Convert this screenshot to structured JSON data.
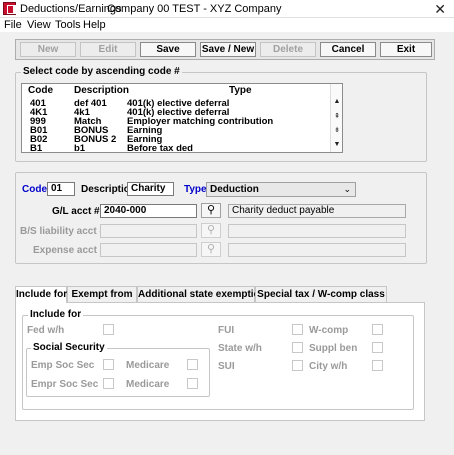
{
  "window": {
    "title": "Deductions/Earnings",
    "company": "Company 00  TEST - XYZ Company",
    "close": "✕"
  },
  "menu": [
    "File",
    "View",
    "Tools",
    "Help"
  ],
  "toolbar": {
    "new": "New",
    "edit": "Edit",
    "save": "Save",
    "save_new": "Save / New",
    "delete": "Delete",
    "cancel": "Cancel",
    "exit": "Exit"
  },
  "select_code": {
    "title": "Select code by ascending code #",
    "headers": {
      "code": "Code",
      "description": "Description",
      "type": "Type"
    },
    "rows": [
      {
        "code": "401",
        "description": "def 401",
        "type": "401(k) elective deferral"
      },
      {
        "code": "4K1",
        "description": "4k1",
        "type": "401(k) elective deferral"
      },
      {
        "code": "999",
        "description": "Match",
        "type": "Employer matching contribution"
      },
      {
        "code": "B01",
        "description": "BONUS",
        "type": "Earning"
      },
      {
        "code": "B02",
        "description": "BONUS 2",
        "type": "Earning"
      },
      {
        "code": "B1",
        "description": "b1",
        "type": "Before tax ded"
      }
    ]
  },
  "detail": {
    "code_label": "Code",
    "code_value": "01",
    "description_label": "Description",
    "description_value": "Charity",
    "type_label": "Type",
    "type_value": "Deduction",
    "gl_label": "G/L acct #",
    "gl_value": "2040-000",
    "gl_desc": "Charity deduct payable",
    "bs_label": "B/S liability acct #",
    "bs_value": "",
    "bs_desc": "",
    "expense_label": "Expense acct #",
    "expense_value": "",
    "expense_desc": ""
  },
  "tabs": [
    "Include for",
    "Exempt from",
    "Additional state exemptions",
    "Special tax / W-comp class"
  ],
  "include_for": {
    "title": "Include for",
    "fed_wh": "Fed w/h",
    "social_security_title": "Social Security",
    "emp_soc_sec": "Emp Soc Sec",
    "medicare_1": "Medicare",
    "empr_soc_sec": "Empr Soc Sec",
    "medicare_2": "Medicare",
    "fui": "FUI",
    "state_wh": "State w/h",
    "sui": "SUI",
    "wcomp": "W-comp",
    "suppl_ben": "Suppl ben",
    "city_wh": "City w/h"
  },
  "colors": {
    "accent_blue": "#0000cc",
    "disabled_gray": "#9a9a9a",
    "app_icon": "#c8102e"
  }
}
